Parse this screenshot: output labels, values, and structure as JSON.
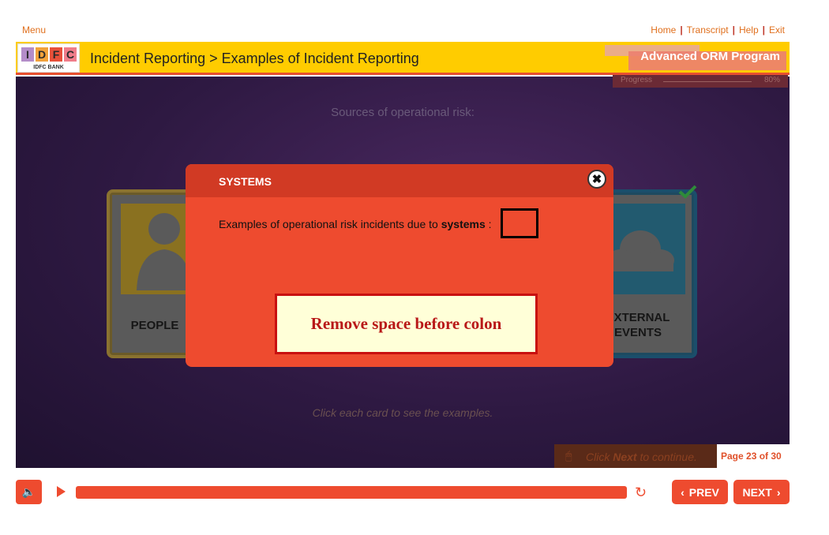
{
  "topbar": {
    "menu_label": "Menu",
    "links": [
      "Home",
      "Transcript",
      "Help",
      "Exit"
    ]
  },
  "header": {
    "logo_letters": [
      "I",
      "D",
      "F",
      "C"
    ],
    "logo_colors": [
      "#b48dc9",
      "#f2a23b",
      "#e8503a",
      "#f07d8a"
    ],
    "logo_sub": "IDFC BANK",
    "title": "Incident Reporting > Examples of Incident Reporting",
    "program": "Advanced ORM Program"
  },
  "progress": {
    "label": "Progress",
    "percent_text": "80%"
  },
  "stage": {
    "sources_label": "Sources of operational risk:",
    "hint": "Click each card to see the examples.",
    "cards": {
      "people": "PEOPLE",
      "external_line1": "EXTERNAL",
      "external_line2": "EVENTS"
    },
    "next_hint_prefix": "Click ",
    "next_hint_bold": "Next",
    "next_hint_suffix": " to continue.",
    "page_count": "Page 23 of 30"
  },
  "popup": {
    "title": "SYSTEMS",
    "close_glyph": "✖",
    "text_prefix": "Examples of operational risk incidents due to ",
    "text_bold": "systems",
    "text_suffix": " :"
  },
  "annotation": {
    "text": "Remove space before colon"
  },
  "controls": {
    "volume_glyph": "🔈",
    "replay_glyph": "↻",
    "prev_label": "PREV",
    "next_label": "NEXT",
    "prev_glyph": "‹",
    "next_glyph": "›"
  },
  "colors": {
    "accent": "#ee4b2f",
    "header_yellow": "#ffcc00",
    "link_orange": "#e0701e",
    "checkmark": "#2e8b3a"
  }
}
